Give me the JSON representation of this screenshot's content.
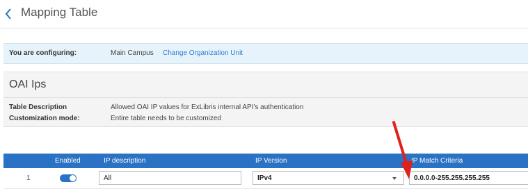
{
  "header": {
    "title": "Mapping Table"
  },
  "config_bar": {
    "label": "You are configuring:",
    "value": "Main Campus",
    "link": "Change Organization Unit"
  },
  "info_panel": {
    "title": "OAI Ips",
    "rows": [
      {
        "key": "Table Description",
        "value": "Allowed OAI IP values for ExLibris internal API's authentication"
      },
      {
        "key": "Customization mode:",
        "value": "Entire table needs to be customized"
      }
    ]
  },
  "table": {
    "columns": [
      "Enabled",
      "IP description",
      "IP Version",
      "IP Match Criteria"
    ],
    "rows": [
      {
        "num": "1",
        "enabled": true,
        "ip_description": "All",
        "ip_version": "IPv4",
        "ip_match": "0.0.0.0-255.255.255.255"
      }
    ]
  },
  "colors": {
    "accent": "#2a72c3",
    "config_bg": "#e6f3fb",
    "link": "#2a7bd3",
    "annotation_arrow": "#e0201b"
  },
  "icons": {
    "back": "chevron-left-icon",
    "select": "chevron-down-icon",
    "annotation": "red-arrow-icon"
  }
}
